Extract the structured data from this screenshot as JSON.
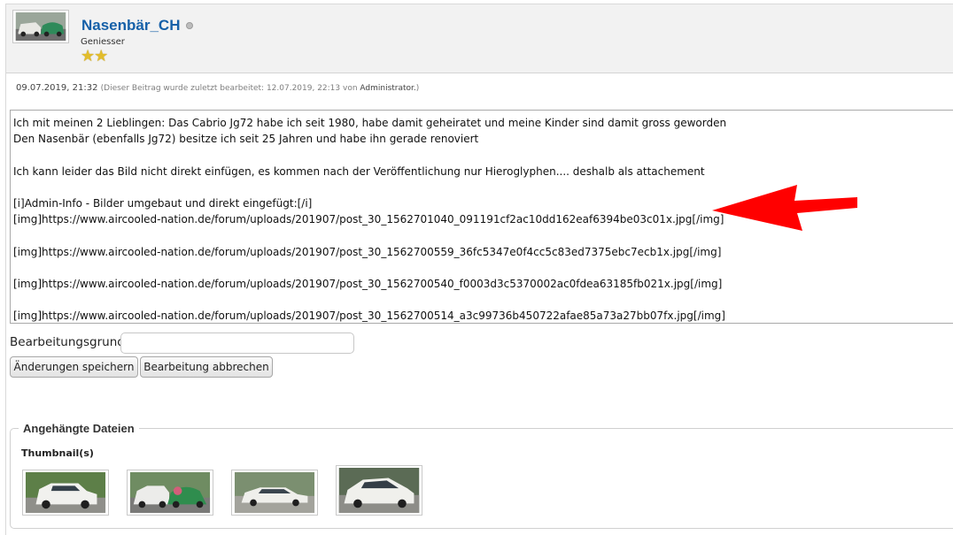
{
  "header": {
    "username": "Nasenbär_CH",
    "rank": "Geniesser",
    "stars": "★★"
  },
  "meta": {
    "date": "09.07.2019, 21:32",
    "edit_note": "(Dieser Beitrag wurde zuletzt bearbeitet: 12.07.2019, 22:13 von ",
    "editor_name": "Administrator.",
    "edit_close": ")"
  },
  "editor": {
    "lines": [
      "Ich mit meinen 2 Lieblingen: Das Cabrio Jg72 habe ich seit 1980, habe damit geheiratet und meine Kinder sind damit gross geworden",
      "Den Nasenbär (ebenfalls Jg72) besitze ich seit 25 Jahren und habe ihn gerade renoviert",
      "",
      "Ich kann leider das Bild nicht direkt einfügen, es kommen nach der Veröffentlichung nur Hieroglyphen.... deshalb als attachement",
      "",
      "[i]Admin-Info - Bilder umgebaut und direkt eingefügt:[/i]",
      "[img]https://www.aircooled-nation.de/forum/uploads/201907/post_30_1562701040_091191cf2ac10dd162eaf6394be03c01x.jpg[/img]",
      "",
      "[img]https://www.aircooled-nation.de/forum/uploads/201907/post_30_1562700559_36fc5347e0f4cc5c83ed7375ebc7ecb1x.jpg[/img]",
      "",
      "[img]https://www.aircooled-nation.de/forum/uploads/201907/post_30_1562700540_f0003d3c5370002ac0fdea63185fb021x.jpg[/img]",
      "",
      "[img]https://www.aircooled-nation.de/forum/uploads/201907/post_30_1562700514_a3c99736b450722afae85a73a27bb07fx.jpg[/img]"
    ]
  },
  "edit_reason": {
    "label": "Bearbeitungsgrund:",
    "value": ""
  },
  "buttons": {
    "save": "Änderungen speichern",
    "cancel": "Bearbeitung abbrechen"
  },
  "attachments": {
    "legend": "Angehängte Dateien",
    "thumbnails_label": "Thumbnail(s)"
  },
  "colors": {
    "username": "#1560a8",
    "arrow": "#ff0000",
    "stars": "#e2bd2c"
  },
  "icons": {
    "status": "offline-dot-icon",
    "rank": "star-icon",
    "annotation": "red-arrow-icon"
  }
}
